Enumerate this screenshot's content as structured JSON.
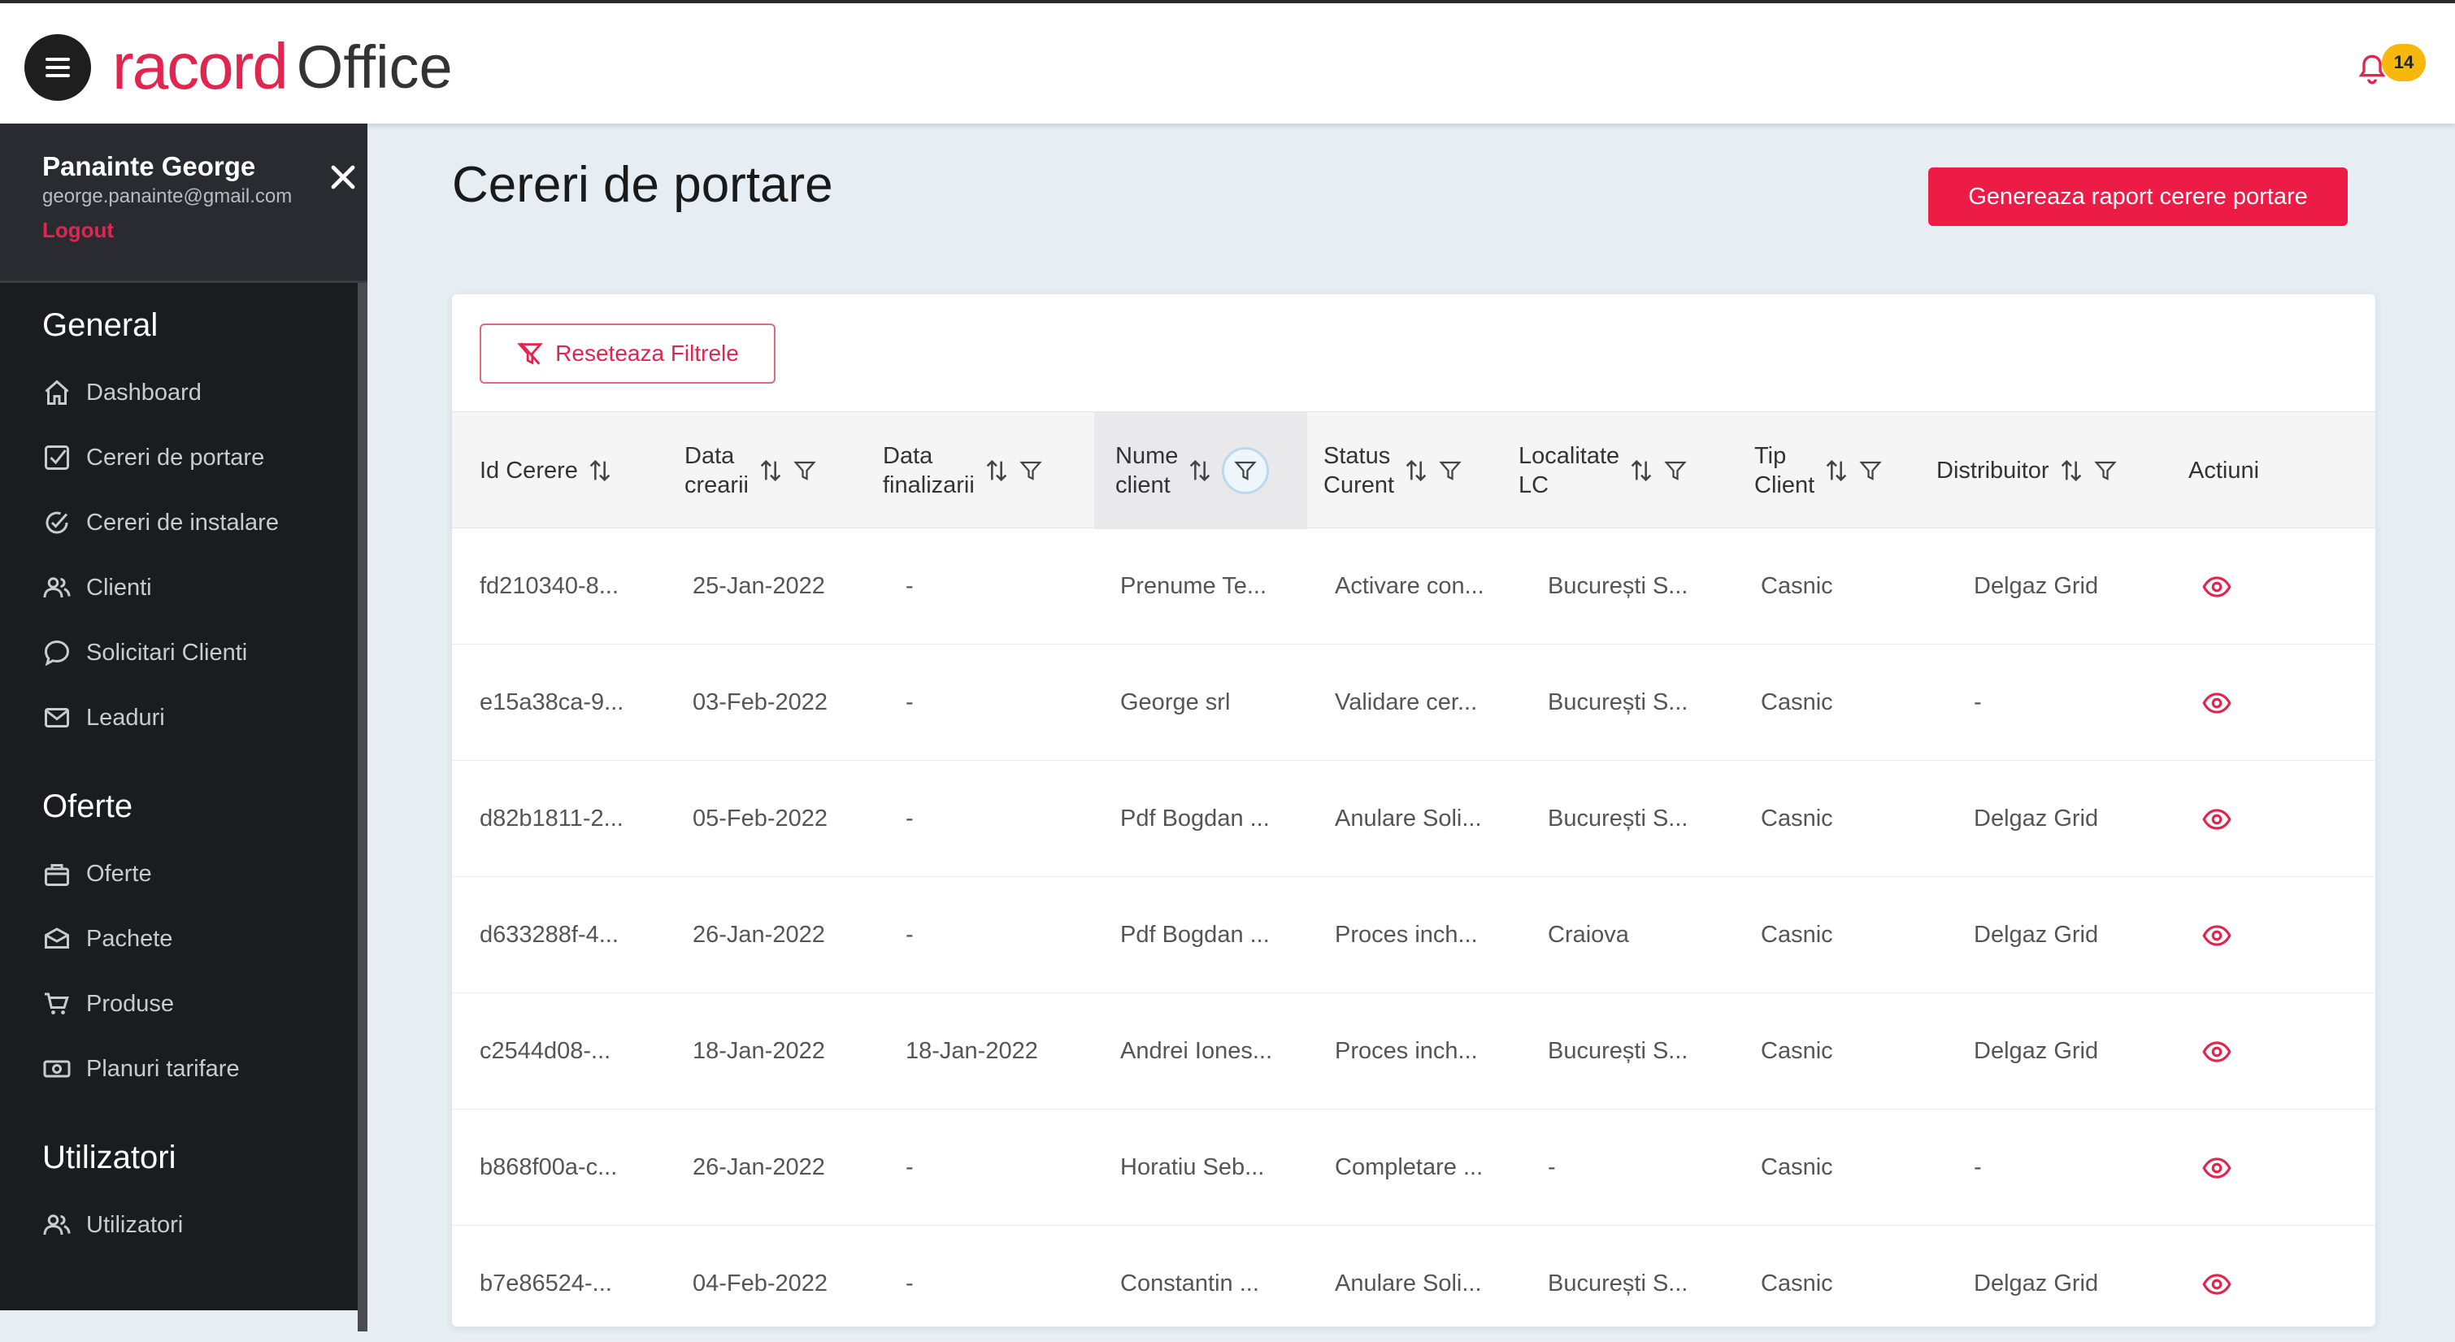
{
  "app": {
    "brand_main": "racord",
    "brand_sub": "Office",
    "notifications": "14"
  },
  "user": {
    "name": "Panainte George",
    "email": "george.panainte@gmail.com",
    "logout": "Logout"
  },
  "sidebar": {
    "sections": [
      {
        "title": "General",
        "items": [
          "Dashboard",
          "Cereri de portare",
          "Cereri de instalare",
          "Clienti",
          "Solicitari Clienti",
          "Leaduri"
        ]
      },
      {
        "title": "Oferte",
        "items": [
          "Oferte",
          "Pachete",
          "Produse",
          "Planuri tarifare"
        ]
      },
      {
        "title": "Utilizatori",
        "items": [
          "Utilizatori"
        ]
      }
    ]
  },
  "page": {
    "title": "Cereri de portare",
    "report_button": "Genereaza raport cerere portare"
  },
  "table": {
    "reset_button": "Reseteaza Filtrele",
    "columns": [
      {
        "label": "Id Cerere"
      },
      {
        "label_line1": "Data",
        "label_line2": "crearii"
      },
      {
        "label_line1": "Data",
        "label_line2": "finalizarii"
      },
      {
        "label_line1": "Nume",
        "label_line2": "client"
      },
      {
        "label_line1": "Status",
        "label_line2": "Curent"
      },
      {
        "label_line1": "Localitate",
        "label_line2": "LC"
      },
      {
        "label_line1": "Tip",
        "label_line2": "Client"
      },
      {
        "label": "Distribuitor"
      },
      {
        "label": "Actiuni"
      }
    ],
    "rows": [
      [
        "fd210340-8...",
        "25-Jan-2022",
        "-",
        "Prenume Te...",
        "Activare con...",
        "București S...",
        "Casnic",
        "Delgaz Grid"
      ],
      [
        "e15a38ca-9...",
        "03-Feb-2022",
        "-",
        "George srl",
        "Validare cer...",
        "București S...",
        "Casnic",
        "-"
      ],
      [
        "d82b1811-2...",
        "05-Feb-2022",
        "-",
        "Pdf Bogdan ...",
        "Anulare Soli...",
        "București S...",
        "Casnic",
        "Delgaz Grid"
      ],
      [
        "d633288f-4...",
        "26-Jan-2022",
        "-",
        "Pdf Bogdan ...",
        "Proces inch...",
        "Craiova",
        "Casnic",
        "Delgaz Grid"
      ],
      [
        "c2544d08-...",
        "18-Jan-2022",
        "18-Jan-2022",
        "Andrei Iones...",
        "Proces inch...",
        "București S...",
        "Casnic",
        "Delgaz Grid"
      ],
      [
        "b868f00a-c...",
        "26-Jan-2022",
        "-",
        "Horatiu Seb...",
        "Completare ...",
        "-",
        "Casnic",
        "-"
      ],
      [
        "b7e86524-...",
        "04-Feb-2022",
        "-",
        "Constantin ...",
        "Anulare Soli...",
        "București S...",
        "Casnic",
        "Delgaz Grid"
      ]
    ]
  }
}
